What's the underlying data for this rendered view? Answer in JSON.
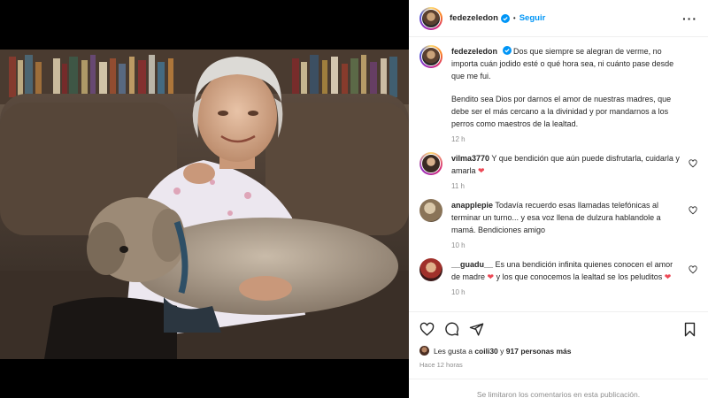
{
  "post": {
    "username": "fedezeledon",
    "separator": "•",
    "follow_label": "Seguir",
    "more_icon": "more-options-icon",
    "caption_p1": "Dos que siempre se alegran de verme, no importa cuán jodido esté o qué hora sea, ni cuánto pase desde que me fui.",
    "caption_p2": "Bendito sea Dios por darnos el amor de nuestras madres, que debe ser el más cercano a la divinidad y por mandarnos a los perros como maestros de la lealtad.",
    "caption_time": "12 h"
  },
  "comments": [
    {
      "user": "vilma3770",
      "text": "Y que bendición que aún puede disfrutarla, cuidarla y amarla",
      "emoji": "❤",
      "time": "11 h"
    },
    {
      "user": "anapplepie",
      "text": "Todavía recuerdo esas llamadas telefónicas al terminar un turno... y esa voz llena de dulzura hablandole a mamá. Bendiciones amigo",
      "emoji": "",
      "time": "10 h"
    },
    {
      "user": "__guadu__",
      "text": "Es una bendición infinita quienes conocen el amor de madre",
      "emoji": "❤",
      "text2": "y los que conocemos la lealtad se los peluditos",
      "emoji2": "❤",
      "time": "10 h"
    }
  ],
  "likes": {
    "prefix": "Les gusta a",
    "user": "coili30",
    "conj": "y",
    "others": "917 personas más"
  },
  "posted_ago": "Hace 12 horas",
  "comments_limited": "Se limitaron los comentarios en esta publicación.",
  "colors": {
    "link_blue": "#0095f6",
    "heart_red": "#ed4956",
    "muted": "#8e8e8e"
  }
}
